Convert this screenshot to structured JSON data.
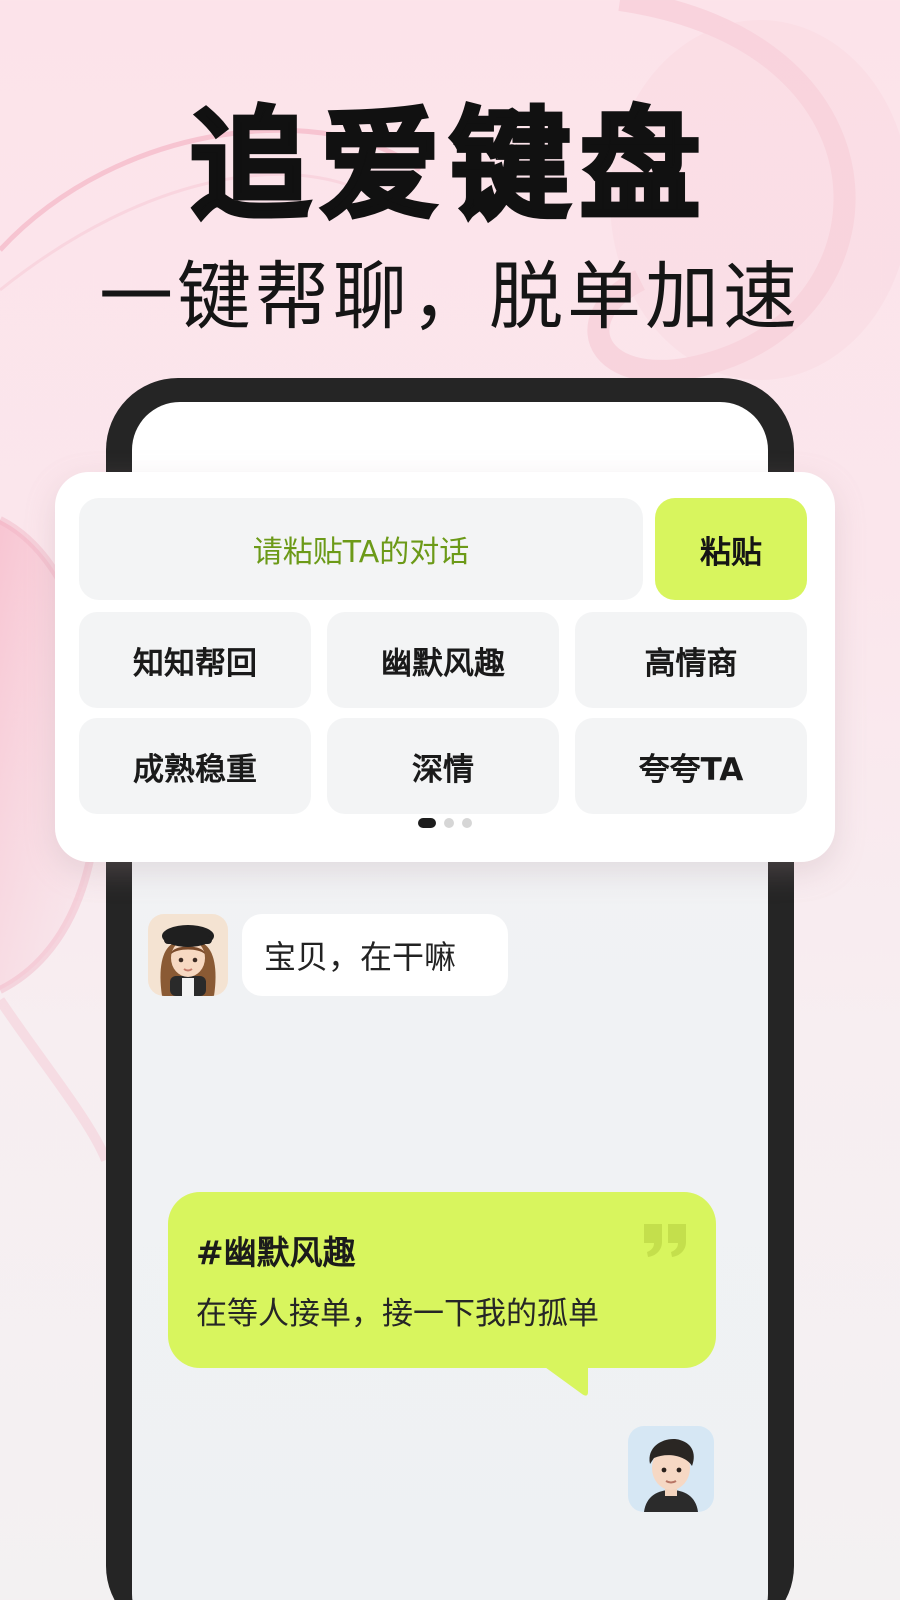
{
  "headline": "追爱键盘",
  "subline": "一键帮聊，脱单加速",
  "keyboard": {
    "paste_placeholder": "请粘贴TA的对话",
    "paste_button": "粘贴",
    "styles": [
      "知知帮回",
      "幽默风趣",
      "高情商",
      "成熟稳重",
      "深情",
      "夸夸TA"
    ],
    "active_page": 1,
    "pages": 3
  },
  "chat": {
    "incoming_message": "宝贝，在干嘛",
    "reply": {
      "tag": "#幽默风趣",
      "text": "在等人接单，接一下我的孤单"
    }
  },
  "colors": {
    "accent_lime": "#d8f55e",
    "placeholder_green": "#6c9a18",
    "phone_frame": "#252525"
  }
}
